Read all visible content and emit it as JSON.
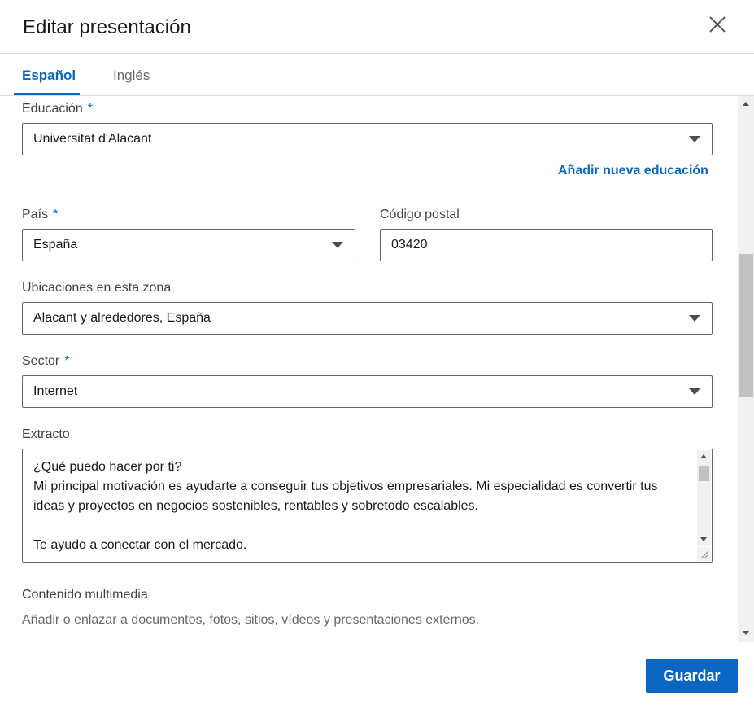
{
  "modal": {
    "title": "Editar presentación",
    "close_icon": "close-icon"
  },
  "tabs": [
    {
      "label": "Español",
      "active": true
    },
    {
      "label": "Inglés",
      "active": false
    }
  ],
  "form": {
    "education": {
      "label": "Educación",
      "required_mark": "*",
      "value": "Universitat d'Alacant",
      "add_link": "Añadir nueva educación"
    },
    "country": {
      "label": "País",
      "required_mark": "*",
      "value": "España"
    },
    "postal_code": {
      "label": "Código postal",
      "value": "03420"
    },
    "locations": {
      "label": "Ubicaciones en esta zona",
      "value": "Alacant y alrededores, España"
    },
    "sector": {
      "label": "Sector",
      "required_mark": "*",
      "value": "Internet"
    },
    "summary": {
      "label": "Extracto",
      "value": "¿Qué puedo hacer por ti?\nMi principal motivación es ayudarte a conseguir tus objetivos empresariales. Mi especialidad es convertir tus ideas y proyectos en negocios sostenibles, rentables y sobretodo escalables.\n\nTe ayudo a conectar con el mercado."
    },
    "media": {
      "title": "Contenido multimedia",
      "description": "Añadir o enlazar a documentos, fotos, sitios, vídeos y presentaciones externos."
    }
  },
  "footer": {
    "save_label": "Guardar"
  },
  "colors": {
    "accent": "#0a66c2"
  }
}
